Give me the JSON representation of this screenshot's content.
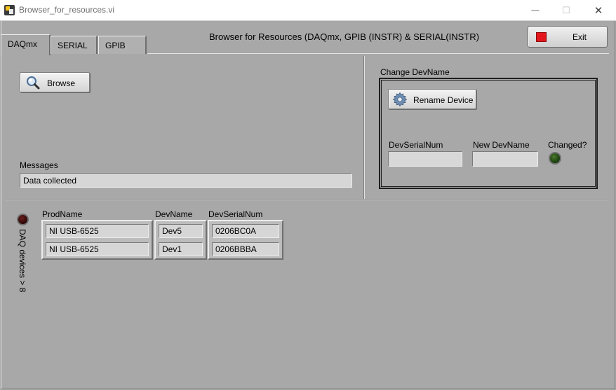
{
  "window": {
    "title": "Browser_for_resources.vi",
    "controls": {
      "minimize": "—",
      "maximize": "☐",
      "close": "✕"
    }
  },
  "tabs": [
    {
      "label": "DAQmx",
      "active": true
    },
    {
      "label": "SERIAL",
      "active": false
    },
    {
      "label": "GPIB",
      "active": false
    }
  ],
  "header": {
    "title": "Browser for Resources (DAQmx, GPIB (INSTR) & SERIAL(INSTR)"
  },
  "exit_button": {
    "label": "Exit",
    "icon": "stop-square-icon",
    "icon_color": "#e4161b"
  },
  "browse_button": {
    "label": "Browse",
    "icon": "magnifier-icon"
  },
  "messages": {
    "label": "Messages",
    "value": "Data collected"
  },
  "change_devname": {
    "title": "Change DevName",
    "rename_button": {
      "label": "Rename Device",
      "icon": "gear-icon"
    },
    "dev_serial_num": {
      "label": "DevSerialNum",
      "value": ""
    },
    "new_dev_name": {
      "label": "New DevName",
      "value": ""
    },
    "changed": {
      "label": "Changed?",
      "state": false,
      "color": "#2e5a1a"
    }
  },
  "daq_devices": {
    "indicator_label": "DAQ devices > 8",
    "indicator_state": false,
    "indicator_color": "#4a1010",
    "columns": [
      "ProdName",
      "DevName",
      "DevSerialNum"
    ],
    "rows": [
      [
        "NI USB-6525",
        "Dev5",
        "0206BC0A"
      ],
      [
        "NI USB-6525",
        "Dev1",
        "0206BBBA"
      ]
    ]
  }
}
